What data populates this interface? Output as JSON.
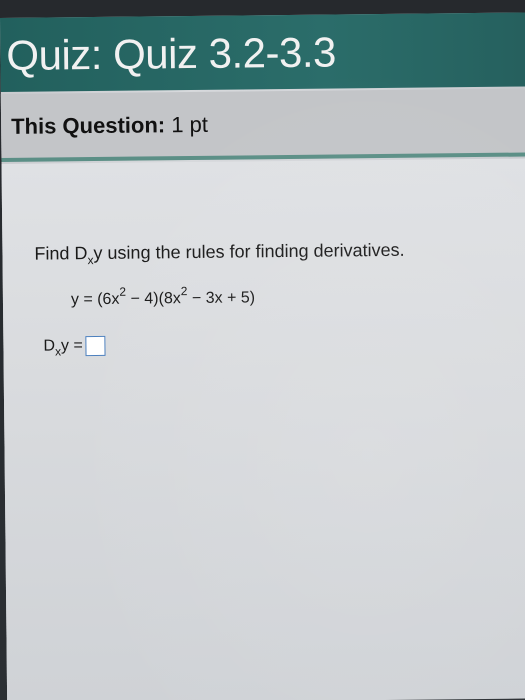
{
  "header": {
    "quiz_prefix": "Quiz:",
    "quiz_name": "Quiz 3.2-3.3"
  },
  "question_info": {
    "label": "This Question:",
    "points": "1 pt"
  },
  "question": {
    "prompt_before": "Find D",
    "prompt_sub": "x",
    "prompt_after": "y using the rules for finding derivatives.",
    "equation": {
      "part1": "y = (6x",
      "sup1": "2",
      "part2": " − 4)(8x",
      "sup2": "2",
      "part3": " − 3x + 5)"
    },
    "answer_label": {
      "d": "D",
      "sub": "x",
      "rest": "y ="
    }
  },
  "colors": {
    "header_bg": "#2b6d6a",
    "subheader_bg": "#c3c5c8",
    "answer_box_border": "#4b7fbd"
  }
}
